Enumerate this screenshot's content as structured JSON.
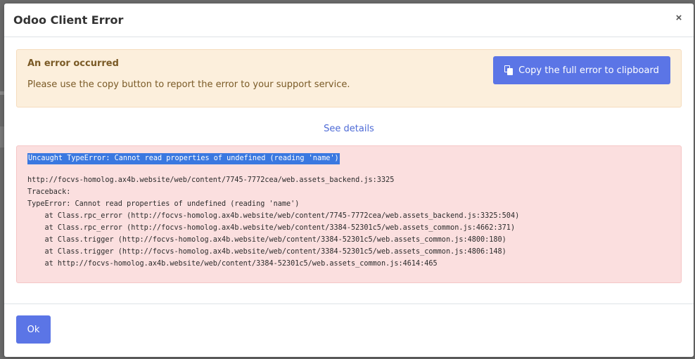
{
  "dialog": {
    "title": "Odoo Client Error",
    "close_glyph": "×"
  },
  "alert": {
    "title": "An error occurred",
    "message": "Please use the copy button to report the error to your support service.",
    "copy_button_label": "Copy the full error to clipboard",
    "copy_icon": "clipboard-copy-icon",
    "background_color": "#fcefdc",
    "text_color": "#7a5a26"
  },
  "details_link": "See details",
  "error": {
    "headline": "Uncaught TypeError: Cannot read properties of undefined (reading 'name')",
    "lines": [
      "http://focvs-homolog.ax4b.website/web/content/7745-7772cea/web.assets_backend.js:3325",
      "Traceback:",
      "TypeError: Cannot read properties of undefined (reading 'name')",
      "    at Class.rpc_error (http://focvs-homolog.ax4b.website/web/content/7745-7772cea/web.assets_backend.js:3325:504)",
      "    at Class.rpc_error (http://focvs-homolog.ax4b.website/web/content/3384-52301c5/web.assets_common.js:4662:371)",
      "    at Class.trigger (http://focvs-homolog.ax4b.website/web/content/3384-52301c5/web.assets_common.js:4800:180)",
      "    at Class.trigger (http://focvs-homolog.ax4b.website/web/content/3384-52301c5/web.assets_common.js:4806:148)",
      "    at http://focvs-homolog.ax4b.website/web/content/3384-52301c5/web.assets_common.js:4614:465"
    ],
    "background_color": "#fbdfdf"
  },
  "footer": {
    "ok_label": "Ok"
  },
  "colors": {
    "primary": "#5b75e6",
    "link": "#4d6ad6",
    "selection": "#3a78e0"
  }
}
